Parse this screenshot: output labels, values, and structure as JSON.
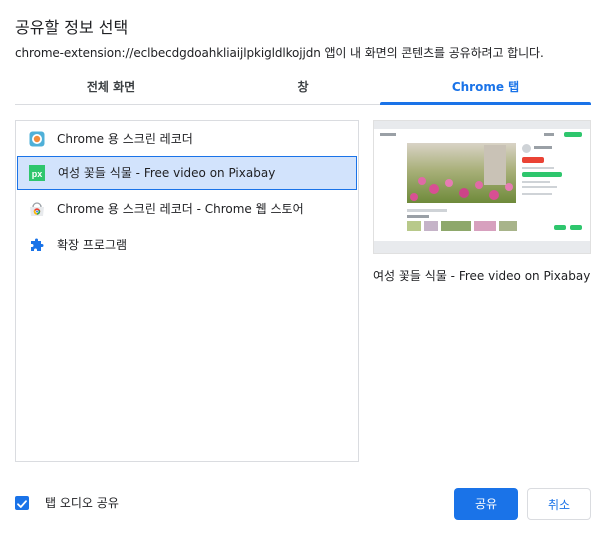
{
  "dialog": {
    "title": "공유할 정보 선택",
    "subtitle": "chrome-extension://eclbecdgdoahkliaijlpkigldlkojjdn 앱이 내 화면의 콘텐츠를 공유하려고 합니다."
  },
  "tabs": [
    {
      "label": "전체 화면",
      "active": false
    },
    {
      "label": "창",
      "active": false
    },
    {
      "label": "Chrome 탭",
      "active": true
    }
  ],
  "list": {
    "items": [
      {
        "label": "Chrome 용 스크린 레코더",
        "icon": "screen-recorder-icon",
        "selected": false
      },
      {
        "label": "여성 꽃들 식물 - Free video on Pixabay",
        "icon": "pixabay-icon",
        "selected": true
      },
      {
        "label": "Chrome 용 스크린 레코더 - Chrome 웹 스토어",
        "icon": "chrome-web-store-icon",
        "selected": false
      },
      {
        "label": "확장 프로그램",
        "icon": "puzzle-icon",
        "selected": false
      }
    ]
  },
  "preview": {
    "caption": "여성 꽃들 식물 - Free video on Pixabay"
  },
  "audio": {
    "label": "탭 오디오 공유",
    "checked": true
  },
  "buttons": {
    "share": "공유",
    "cancel": "취소"
  },
  "colors": {
    "accent": "#1a73e8",
    "selected_bg": "#d2e3fc",
    "pixabay_green": "#2ec66d"
  }
}
